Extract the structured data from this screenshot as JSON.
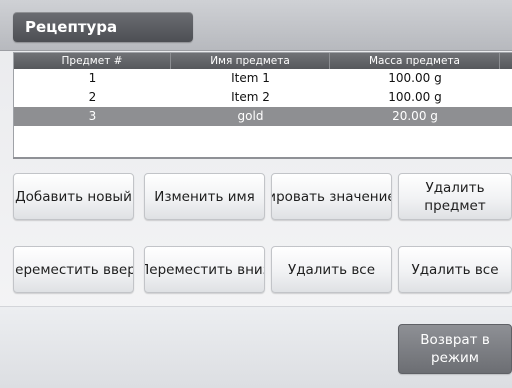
{
  "header": {
    "title": "Рецептура"
  },
  "table": {
    "columns": [
      "Предмет #",
      "Имя предмета",
      "Масса предмета",
      ""
    ],
    "rows": [
      {
        "num": "1",
        "name": "Item 1",
        "mass": "100.00 g",
        "selected": false
      },
      {
        "num": "2",
        "name": "Item 2",
        "mass": "100.00 g",
        "selected": false
      },
      {
        "num": "3",
        "name": "gold",
        "mass": "20.00 g",
        "selected": true
      }
    ]
  },
  "buttons": {
    "add_new": "Добавить новый",
    "rename": "Изменить имя",
    "edit_value": "ировать значение",
    "delete_item": "Удалить предмет",
    "move_up": "Іереместить ввер",
    "move_down": "Переместить вниз",
    "delete_all_1": "Удалить все",
    "delete_all_2": "Удалить все",
    "return": "Возврат в режим"
  },
  "colors": {
    "header_bg": "#5a5c60",
    "selected_row": "#8e8f92",
    "return_button": "#7c7e83"
  }
}
